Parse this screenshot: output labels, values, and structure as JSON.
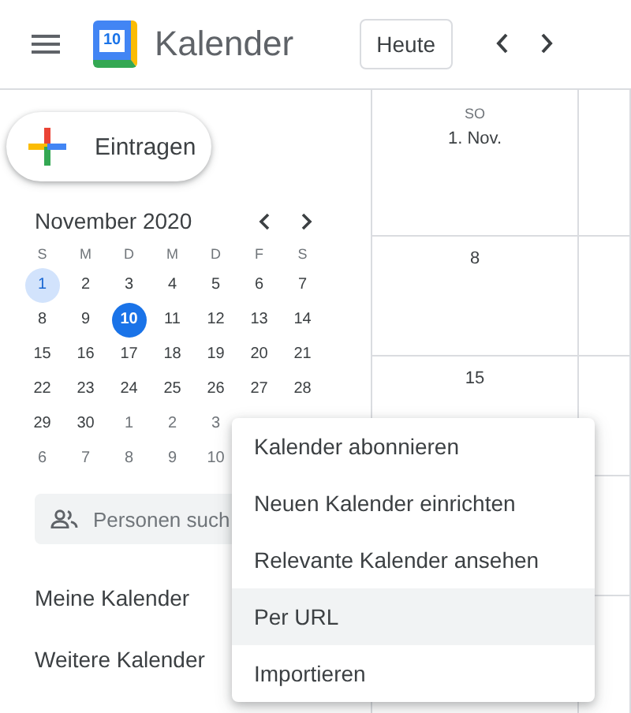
{
  "header": {
    "logo_text": "10",
    "app_name": "Kalender",
    "today_button": "Heute"
  },
  "sidebar": {
    "create_button": "Eintragen",
    "mini_calendar": {
      "title": "November 2020",
      "weekdays": [
        "S",
        "M",
        "D",
        "M",
        "D",
        "F",
        "S"
      ],
      "weeks": [
        [
          {
            "label": "1",
            "other_month": false,
            "selected": true,
            "today": false
          },
          {
            "label": "2",
            "other_month": false,
            "selected": false,
            "today": false
          },
          {
            "label": "3",
            "other_month": false,
            "selected": false,
            "today": false
          },
          {
            "label": "4",
            "other_month": false,
            "selected": false,
            "today": false
          },
          {
            "label": "5",
            "other_month": false,
            "selected": false,
            "today": false
          },
          {
            "label": "6",
            "other_month": false,
            "selected": false,
            "today": false
          },
          {
            "label": "7",
            "other_month": false,
            "selected": false,
            "today": false
          }
        ],
        [
          {
            "label": "8",
            "other_month": false,
            "selected": false,
            "today": false
          },
          {
            "label": "9",
            "other_month": false,
            "selected": false,
            "today": false
          },
          {
            "label": "10",
            "other_month": false,
            "selected": false,
            "today": true
          },
          {
            "label": "11",
            "other_month": false,
            "selected": false,
            "today": false
          },
          {
            "label": "12",
            "other_month": false,
            "selected": false,
            "today": false
          },
          {
            "label": "13",
            "other_month": false,
            "selected": false,
            "today": false
          },
          {
            "label": "14",
            "other_month": false,
            "selected": false,
            "today": false
          }
        ],
        [
          {
            "label": "15",
            "other_month": false,
            "selected": false,
            "today": false
          },
          {
            "label": "16",
            "other_month": false,
            "selected": false,
            "today": false
          },
          {
            "label": "17",
            "other_month": false,
            "selected": false,
            "today": false
          },
          {
            "label": "18",
            "other_month": false,
            "selected": false,
            "today": false
          },
          {
            "label": "19",
            "other_month": false,
            "selected": false,
            "today": false
          },
          {
            "label": "20",
            "other_month": false,
            "selected": false,
            "today": false
          },
          {
            "label": "21",
            "other_month": false,
            "selected": false,
            "today": false
          }
        ],
        [
          {
            "label": "22",
            "other_month": false,
            "selected": false,
            "today": false
          },
          {
            "label": "23",
            "other_month": false,
            "selected": false,
            "today": false
          },
          {
            "label": "24",
            "other_month": false,
            "selected": false,
            "today": false
          },
          {
            "label": "25",
            "other_month": false,
            "selected": false,
            "today": false
          },
          {
            "label": "26",
            "other_month": false,
            "selected": false,
            "today": false
          },
          {
            "label": "27",
            "other_month": false,
            "selected": false,
            "today": false
          },
          {
            "label": "28",
            "other_month": false,
            "selected": false,
            "today": false
          }
        ],
        [
          {
            "label": "29",
            "other_month": false,
            "selected": false,
            "today": false
          },
          {
            "label": "30",
            "other_month": false,
            "selected": false,
            "today": false
          },
          {
            "label": "1",
            "other_month": true,
            "selected": false,
            "today": false
          },
          {
            "label": "2",
            "other_month": true,
            "selected": false,
            "today": false
          },
          {
            "label": "3",
            "other_month": true,
            "selected": false,
            "today": false
          }
        ],
        [
          {
            "label": "6",
            "other_month": true,
            "selected": false,
            "today": false
          },
          {
            "label": "7",
            "other_month": true,
            "selected": false,
            "today": false
          },
          {
            "label": "8",
            "other_month": true,
            "selected": false,
            "today": false
          },
          {
            "label": "9",
            "other_month": true,
            "selected": false,
            "today": false
          },
          {
            "label": "10",
            "other_month": true,
            "selected": false,
            "today": false
          }
        ]
      ]
    },
    "search_people": {
      "placeholder": "Personen such"
    },
    "sections": [
      "Meine Kalender",
      "Weitere Kalender"
    ]
  },
  "month_grid": {
    "first_column": [
      {
        "weekday": "SO",
        "date": "1. Nov."
      },
      {
        "date": "8"
      },
      {
        "date": "15"
      }
    ]
  },
  "menu": {
    "items": [
      {
        "label": "Kalender abonnieren",
        "selected": false
      },
      {
        "label": "Neuen Kalender einrichten",
        "selected": false
      },
      {
        "label": "Relevante Kalender ansehen",
        "selected": false
      },
      {
        "label": "Per URL",
        "selected": true
      },
      {
        "label": "Importieren",
        "selected": false
      }
    ]
  }
}
